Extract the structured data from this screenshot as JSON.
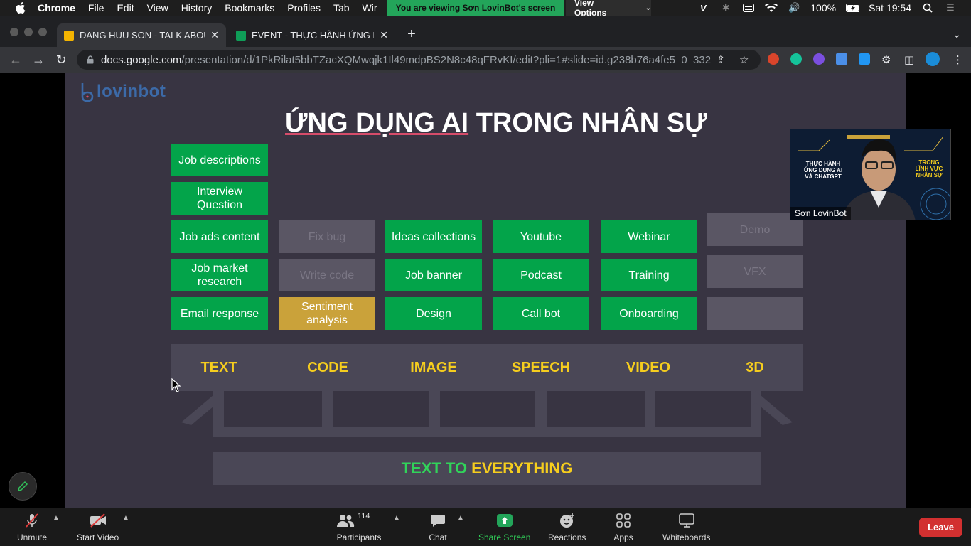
{
  "menubar": {
    "app_name": "Chrome",
    "items": [
      "File",
      "Edit",
      "View",
      "History",
      "Bookmarks",
      "Profiles",
      "Tab",
      "Wir"
    ],
    "share_banner": "You are viewing Sơn LovinBot's screen",
    "view_options": "View Options",
    "battery": "100%",
    "clock": "Sat 19:54"
  },
  "tabs": [
    {
      "title": "DANG HUU SON - TALK ABOUT",
      "favicon_color": "#f4b400",
      "active": true
    },
    {
      "title": "EVENT - THỰC HÀNH ỨNG DỤ",
      "favicon_color": "#0f9d58",
      "active": false
    }
  ],
  "address_bar": {
    "host": "docs.google.com",
    "path": "/presentation/d/1PkRilat5bbTZacXQMwqjk1Il49mdpBS2N8c48qFRvKI/edit?pli=1#slide=id.g238b76a4fe5_0_332"
  },
  "slide": {
    "logo_text": "lovinbot",
    "title_underlined": "ỨNG DỤNG AI",
    "title_rest": "TRONG NHÂN SỰ",
    "columns": [
      {
        "category": "TEXT",
        "cards": [
          {
            "label": "Job descriptions",
            "style": "green"
          },
          {
            "label": "Interview Question",
            "style": "green"
          },
          {
            "label": "Job ads content",
            "style": "green"
          },
          {
            "label": "Job market research",
            "style": "green"
          },
          {
            "label": "Email response",
            "style": "green"
          }
        ]
      },
      {
        "category": "CODE",
        "cards": [
          {
            "label": "Fix bug",
            "style": "gray"
          },
          {
            "label": "Write code",
            "style": "gray"
          },
          {
            "label": "Sentiment analysis",
            "style": "gold"
          }
        ]
      },
      {
        "category": "IMAGE",
        "cards": [
          {
            "label": "Ideas collections",
            "style": "green"
          },
          {
            "label": "Job banner",
            "style": "green"
          },
          {
            "label": "Design",
            "style": "green"
          }
        ]
      },
      {
        "category": "SPEECH",
        "cards": [
          {
            "label": "Youtube",
            "style": "green"
          },
          {
            "label": "Podcast",
            "style": "green"
          },
          {
            "label": "Call bot",
            "style": "green"
          }
        ]
      },
      {
        "category": "VIDEO",
        "cards": [
          {
            "label": "Webinar",
            "style": "green"
          },
          {
            "label": "Training",
            "style": "green"
          },
          {
            "label": "Onboarding",
            "style": "green"
          }
        ]
      },
      {
        "category": "3D",
        "cards": [
          {
            "label": "Demo",
            "style": "gray"
          },
          {
            "label": "VFX",
            "style": "gray"
          },
          {
            "label": "",
            "style": "gray"
          }
        ]
      }
    ],
    "footer_green": "TEXT TO",
    "footer_yellow": "EVERYTHING"
  },
  "webcam": {
    "participant_name": "Sơn LovinBot",
    "banner_left": "THỰC HÀNH ỨNG DỤNG AI VÀ CHATGPT",
    "banner_right": "TRONG LĨNH VỰC NHÂN SỰ"
  },
  "zoom_controls": {
    "unmute": "Unmute",
    "start_video": "Start Video",
    "participants": "Participants",
    "participants_count": "114",
    "chat": "Chat",
    "share_screen": "Share Screen",
    "reactions": "Reactions",
    "apps": "Apps",
    "whiteboards": "Whiteboards",
    "leave": "Leave"
  },
  "colors": {
    "card_green": "#03a44a",
    "card_gold": "#caa23a",
    "category_yellow": "#f5cd1e",
    "slide_bg": "#383442",
    "leave_red": "#d23030",
    "share_green": "#23a55a"
  }
}
